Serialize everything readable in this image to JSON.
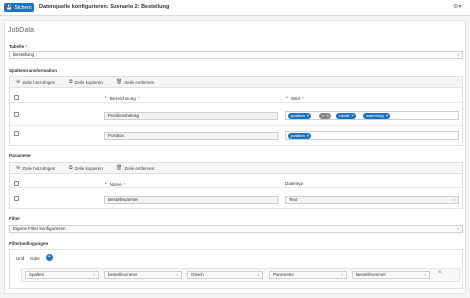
{
  "header": {
    "save_label": "Sichern",
    "save_icon": "save-icon",
    "title": "Datenquelle konfigurieren: Szenario 2: Bestellung",
    "settings_icon": "settings-icon"
  },
  "section_title": "JobData",
  "table_field": {
    "label": "Tabelle",
    "value": "Bestellung"
  },
  "column_transform": {
    "title": "Spaltentransformation",
    "toolbar": {
      "add": "Zeile hinzufügen",
      "copy": "Zeile kopieren",
      "delete": "Zeile entfernen"
    },
    "columns": {
      "name": "Bezeichnung",
      "value": "Wert"
    },
    "rows": [
      {
        "name": "Positionsbetrag",
        "tags": [
          "position",
          "×",
          "rabatt",
          "waehrung"
        ]
      },
      {
        "name": "Position",
        "tags": [
          "position"
        ]
      }
    ]
  },
  "parameters": {
    "title": "Parameter",
    "toolbar": {
      "add": "Zeile hinzufügen",
      "copy": "Zeile kopieren",
      "delete": "Zeile entfernen"
    },
    "columns": {
      "name": "Name",
      "type": "Datentyp"
    },
    "rows": [
      {
        "name": "Bestellnummer",
        "type": "Text"
      }
    ]
  },
  "filter": {
    "label": "Filter",
    "value": "Eigene Filter konfigurieren"
  },
  "filter_conditions": {
    "title": "Filterbedingungen",
    "and": "Und",
    "or": "Oder",
    "add": "+",
    "row": {
      "left_type": "Spalten",
      "left_value": "bestellnummer",
      "operator": "Gleich",
      "right_type": "Parameter",
      "right_value": "Bestellnummer",
      "remove": "×"
    }
  }
}
